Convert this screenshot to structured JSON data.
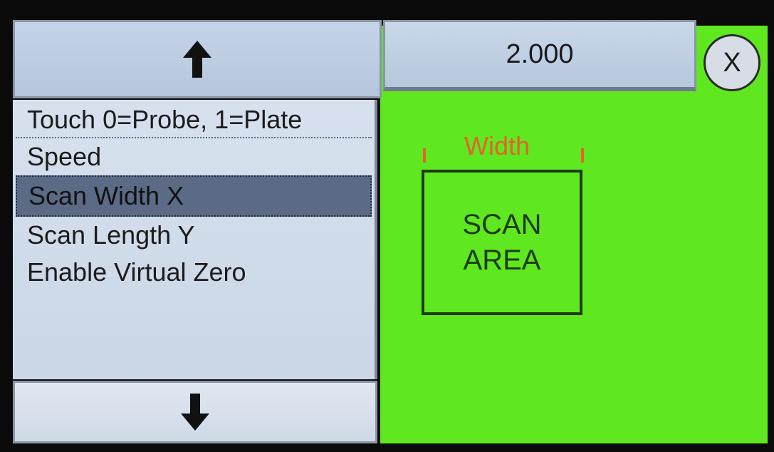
{
  "toolbar": {
    "up_icon": "arrow-up-icon",
    "down_icon": "arrow-down-icon",
    "value": "2.000",
    "close_label": "X"
  },
  "menu": {
    "items": [
      {
        "label": "Touch 0=Probe, 1=Plate"
      },
      {
        "label": "Speed"
      },
      {
        "label": "Scan Width X",
        "selected": true
      },
      {
        "label": "Scan Length Y"
      },
      {
        "label": "Enable Virtual Zero"
      }
    ]
  },
  "diagram": {
    "width_label": "Width",
    "scan_line1": "SCAN",
    "scan_line2": "AREA"
  },
  "colors": {
    "panel_green": "#5fe81f",
    "width_accent": "#e8612a",
    "selected_row": "#5b6b86"
  }
}
